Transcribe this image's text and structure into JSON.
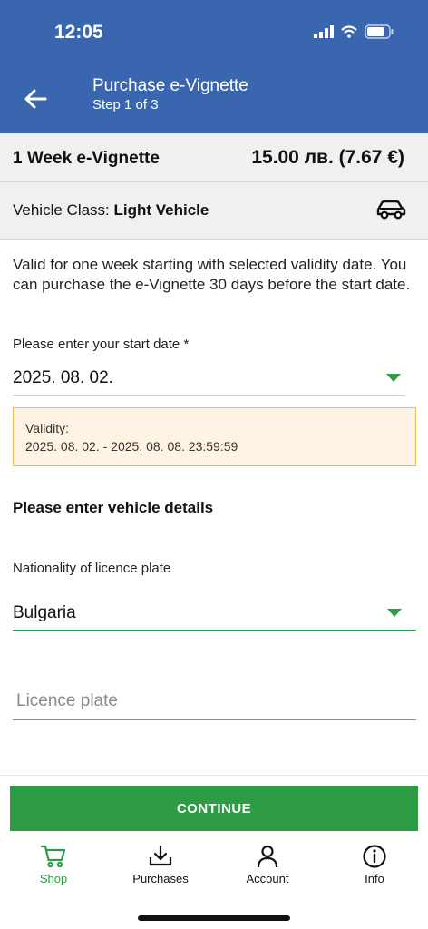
{
  "status_bar": {
    "time": "12:05"
  },
  "header": {
    "title": "Purchase e-Vignette",
    "subtitle": "Step 1 of 3"
  },
  "product": {
    "name": "1 Week e-Vignette",
    "price": "15.00 лв. (7.67 €)"
  },
  "vehicle_class": {
    "label": "Vehicle Class: ",
    "value": "Light Vehicle",
    "icon": "car-icon"
  },
  "description": "Valid for one week starting with selected validity date. You can purchase the e-Vignette 30 days before the start date.",
  "start_date": {
    "label": "Please enter your start date *",
    "value": "2025. 08. 02."
  },
  "validity": {
    "label": "Validity:",
    "value": "2025. 08. 02. - 2025. 08. 08. 23:59:59"
  },
  "vehicle_section_title": "Please enter vehicle details",
  "nationality": {
    "label": "Nationality of licence plate",
    "value": "Bulgaria"
  },
  "licence_plate": {
    "placeholder": "Licence plate",
    "value": ""
  },
  "continue_label": "CONTINUE",
  "tabs": [
    {
      "label": "Shop",
      "icon": "cart-icon",
      "active": true
    },
    {
      "label": "Purchases",
      "icon": "download-icon",
      "active": false
    },
    {
      "label": "Account",
      "icon": "person-icon",
      "active": false
    },
    {
      "label": "Info",
      "icon": "info-icon",
      "active": false
    }
  ],
  "colors": {
    "header": "#3a66b0",
    "accent": "#2e9b45",
    "validity_bg": "#fff4e3",
    "validity_border": "#f0b954"
  }
}
